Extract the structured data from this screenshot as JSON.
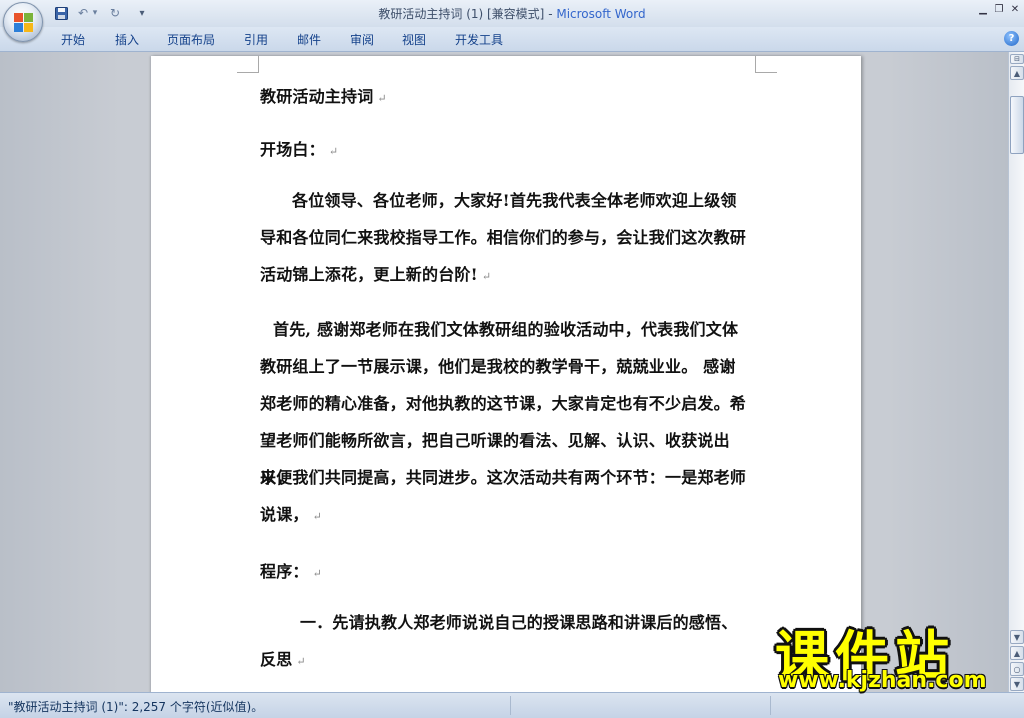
{
  "window": {
    "title_doc": "教研活动主持词 (1) [兼容模式]",
    "title_sep": " - ",
    "title_app": "Microsoft Word",
    "minimize_glyph": "▁",
    "restore_glyph": "❐",
    "close_glyph": "✕"
  },
  "quick_access": {
    "save_icon": "save-icon",
    "undo_glyph": "↶",
    "redo_glyph": "↻",
    "customize_glyph": "▾"
  },
  "ribbon": {
    "tabs": [
      "开始",
      "插入",
      "页面布局",
      "引用",
      "邮件",
      "审阅",
      "视图",
      "开发工具"
    ],
    "help_glyph": "?"
  },
  "document": {
    "paragraphs": [
      "教研活动主持词",
      "开场白：",
      "各位领导、各位老师，大家好!首先我代表全体老师欢迎上级领",
      "导和各位同仁来我校指导工作。相信你们的参与，会让我们这次教研",
      "活动锦上添花，更上新的台阶!",
      "首先, 感谢郑老师在我们文体教研组的验收活动中，代表我们文体",
      "教研组上了一节展示课，他们是我校的教学骨干，兢兢业业。 感谢",
      "郑老师的精心准备，对他执教的这节课，大家肯定也有不少启发。希",
      "望老师们能畅所欲言，把自己听课的看法、见解、认识、收获说出来，",
      "以便我们共同提高，共同进步。这次活动共有两个环节：一是郑老师",
      "说课，",
      "程序：",
      "一．先请执教人郑老师说说自己的授课思路和讲课后的感悟、",
      "反思"
    ],
    "paragraph_mark": "↵"
  },
  "scrollbar": {
    "up_glyph": "▲",
    "down_glyph": "▼",
    "prev_page_glyph": "▲",
    "select_browse_glyph": "○",
    "next_page_glyph": "▼",
    "ruler_glyph": "⊟"
  },
  "status": {
    "text": "\"教研活动主持词 (1)\": 2,257 个字符(近似值)。"
  },
  "watermark": {
    "title": "课件站",
    "url": "www.kjzhan.com"
  }
}
